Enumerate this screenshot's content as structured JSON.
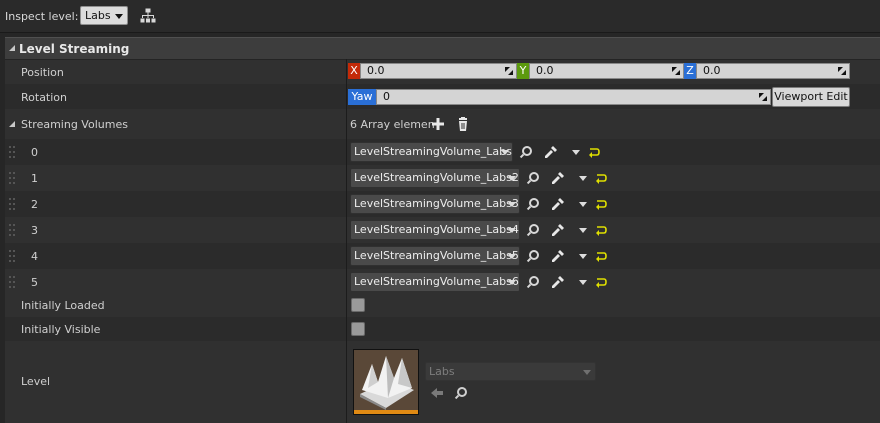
{
  "toolbar": {
    "inspect_label": "Inspect level:",
    "inspect_value": "Labs",
    "hierarchy_icon": "hierarchy-icon"
  },
  "category": {
    "title": "Level Streaming"
  },
  "position": {
    "label": "Position",
    "x_axis": "X",
    "x": "0.0",
    "y_axis": "Y",
    "y": "0.0",
    "z_axis": "Z",
    "z": "0.0"
  },
  "rotation": {
    "label": "Rotation",
    "yaw_label": "Yaw",
    "yaw": "0",
    "viewport_edit": "Viewport Edit"
  },
  "streaming_volumes": {
    "label": "Streaming Volumes",
    "count": "6 Array elemen",
    "items": [
      {
        "index": "0",
        "value": "LevelStreamingVolume_Labs"
      },
      {
        "index": "1",
        "value": "LevelStreamingVolume_Labs2"
      },
      {
        "index": "2",
        "value": "LevelStreamingVolume_Labs3"
      },
      {
        "index": "3",
        "value": "LevelStreamingVolume_Labs4"
      },
      {
        "index": "4",
        "value": "LevelStreamingVolume_Labs5"
      },
      {
        "index": "5",
        "value": "LevelStreamingVolume_Labs6"
      }
    ]
  },
  "initially_loaded": {
    "label": "Initially Loaded",
    "checked": false
  },
  "initially_visible": {
    "label": "Initially Visible",
    "checked": false
  },
  "level": {
    "label": "Level",
    "asset": "Labs"
  },
  "colors": {
    "x_axis": "#c42a08",
    "y_axis": "#5c9a0e",
    "z_axis": "#2a6fd6",
    "yaw": "#2a6fd6",
    "accent": "#e08a14"
  }
}
